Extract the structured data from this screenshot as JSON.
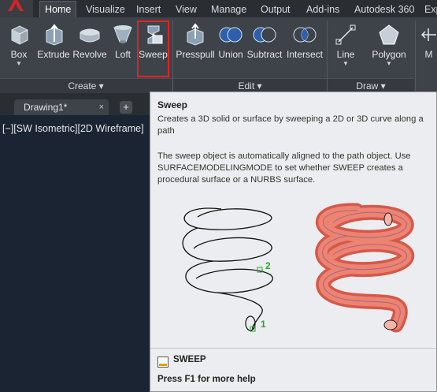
{
  "tabbar": {
    "tabs": [
      "Home",
      "Visualize",
      "Insert",
      "View",
      "Manage",
      "Output",
      "Add-ins",
      "Autodesk 360",
      "Exp"
    ]
  },
  "ribbon": {
    "create_tools": [
      "Box",
      "Extrude",
      "Revolve",
      "Loft",
      "Sweep"
    ],
    "edit_tools": [
      "Presspull",
      "Union",
      "Subtract",
      "Intersect"
    ],
    "draw_tools": [
      "Line",
      "Polygon"
    ],
    "extra_tool": "M",
    "panels": {
      "create": "Create ▾",
      "edit": "Edit ▾",
      "draw": "Draw ▾"
    }
  },
  "file_tabs": {
    "drawing": "Drawing1*",
    "close": "×",
    "new": "+"
  },
  "viewport": {
    "label": "[−][SW Isometric][2D Wireframe]"
  },
  "tooltip": {
    "title": "Sweep",
    "description": "Creates a 3D solid or surface by sweeping a 2D or 3D curve along a path",
    "details": "The sweep object is automatically aligned to the path object. Use SURFACEMODELINGMODE to set whether SWEEP creates a procedural surface or a NURBS surface.",
    "marker_1": "1",
    "marker_2": "2",
    "command": "SWEEP",
    "help": "Press F1 for more help"
  },
  "colors": {
    "ribbon_bg": "#3e4349",
    "viewport_bg": "#1b2433",
    "highlight": "#e0232b",
    "tooltip_bg": "#ecedf0",
    "sweep_tube": "#e85b4a"
  },
  "icons": [
    "box-icon",
    "extrude-icon",
    "revolve-icon",
    "loft-icon",
    "sweep-icon",
    "presspull-icon",
    "union-icon",
    "subtract-icon",
    "intersect-icon",
    "line-icon",
    "polygon-icon"
  ]
}
